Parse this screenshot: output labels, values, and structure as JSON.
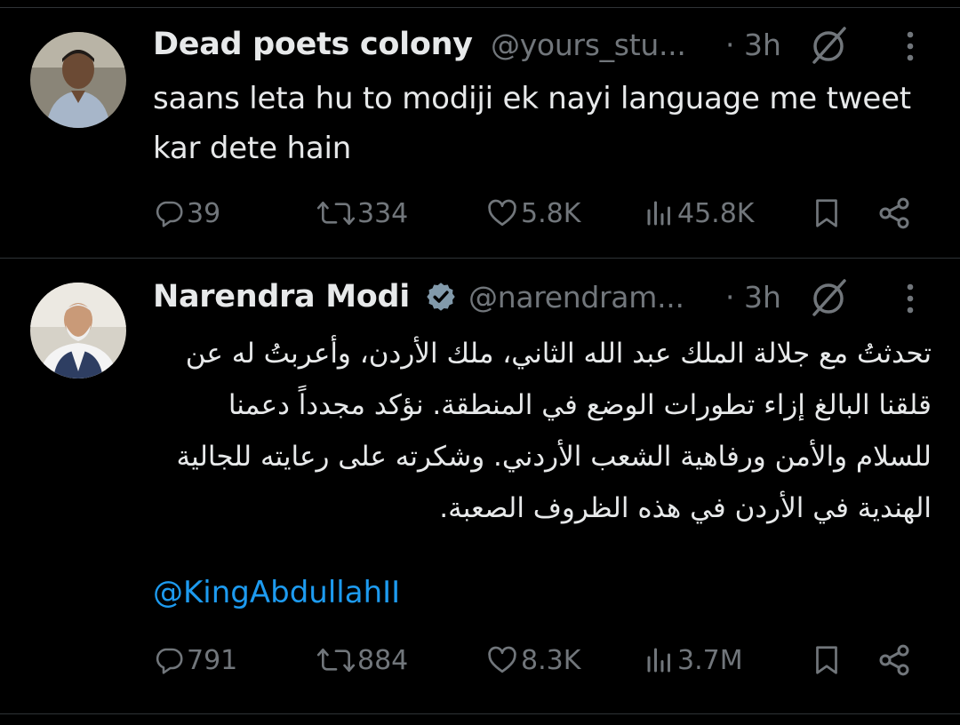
{
  "tweets": [
    {
      "name": "Dead poets colony",
      "handle": "@yours_stu...",
      "time": "· 3h",
      "text": "saans leta hu to modiji ek nayi language me tweet kar dete hain",
      "stats": {
        "replies": "39",
        "reposts": "334",
        "likes": "5.8K",
        "views": "45.8K"
      }
    },
    {
      "name": "Narendra Modi",
      "handle": "@narendram...",
      "time": "· 3h",
      "text": "تحدثتُ مع جلالة الملك عبد الله الثاني، ملك الأردن، وأعربتُ له عن قلقنا البالغ إزاء تطورات الوضع في المنطقة. نؤكد مجدداً دعمنا للسلام والأمن ورفاهية الشعب الأردني. وشكرته على رعايته للجالية الهندية في الأردن في هذه الظروف الصعبة.",
      "mention": "@KingAbdullahII",
      "stats": {
        "replies": "791",
        "reposts": "884",
        "likes": "8.3K",
        "views": "3.7M"
      }
    }
  ],
  "icons": {
    "reply": "reply-icon",
    "repost": "repost-icon",
    "like": "like-icon",
    "views": "views-icon",
    "bookmark": "bookmark-icon",
    "share": "share-icon",
    "grok": "grok-icon",
    "more": "more-icon",
    "verified": "verified-badge-icon"
  },
  "colors": {
    "background": "#000000",
    "primary_text": "#e7e9ea",
    "secondary_text": "#71767b",
    "link": "#1d9bf0",
    "divider": "#2f3336"
  }
}
